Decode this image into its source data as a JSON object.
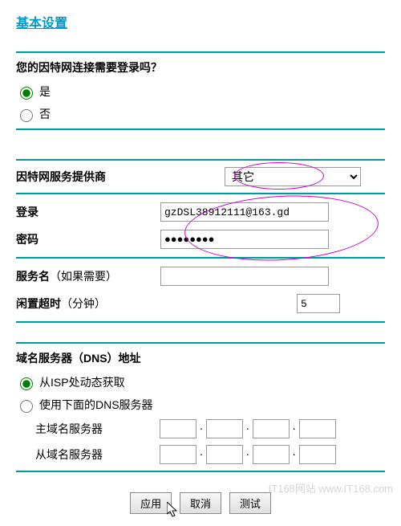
{
  "title": "基本设置",
  "funnel": {
    "heading": "您的因特网连接需要登录吗？",
    "options": {
      "yes": "是",
      "no": "否"
    },
    "selected": "yes"
  },
  "isp": {
    "label": "因特网服务提供商",
    "selected": "其它"
  },
  "login": {
    "label": "登录",
    "value": "gzDSL38912111@163.gd"
  },
  "password": {
    "label": "密码",
    "value": "●●●●●●●●"
  },
  "service": {
    "label": "服务名",
    "hint": "（如果需要）",
    "value": ""
  },
  "idle": {
    "label": "闲置超时",
    "hint": "（分钟）",
    "value": "5"
  },
  "dns": {
    "heading": "域名服务器（DNS）地址",
    "auto": "从ISP处动态获取",
    "manual": "使用下面的DNS服务器",
    "primary": "主域名服务器",
    "secondary": "从域名服务器",
    "selected": "auto"
  },
  "buttons": {
    "apply": "应用",
    "cancel": "取消",
    "test": "测试"
  },
  "watermark": "IT168网站 www.IT168.com"
}
